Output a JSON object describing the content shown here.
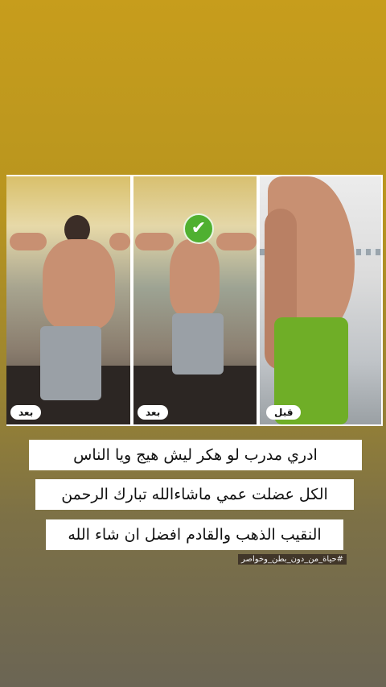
{
  "photos": [
    {
      "id": "after-back",
      "label": "بعد"
    },
    {
      "id": "after-front",
      "label": "بعد",
      "badge": "checkmark"
    },
    {
      "id": "before-side",
      "label": "قبل"
    }
  ],
  "caption": {
    "line1": "ادري مدرب لو هكر ليش هيج ويا الناس",
    "line2": "الكل عضلت عمي ماشاءالله تبارك الرحمن",
    "line3": "النقيب الذهب والقادم افضل ان شاء الله"
  },
  "hashtag": "#حياة_من_دون_بطن_وخواصر",
  "colors": {
    "background_top": "#c79d1c",
    "background_bottom": "#6b6554",
    "check_green": "#4fb030",
    "shorts_green": "#6fae27"
  },
  "icons": {
    "badge": "checkmark-icon"
  }
}
